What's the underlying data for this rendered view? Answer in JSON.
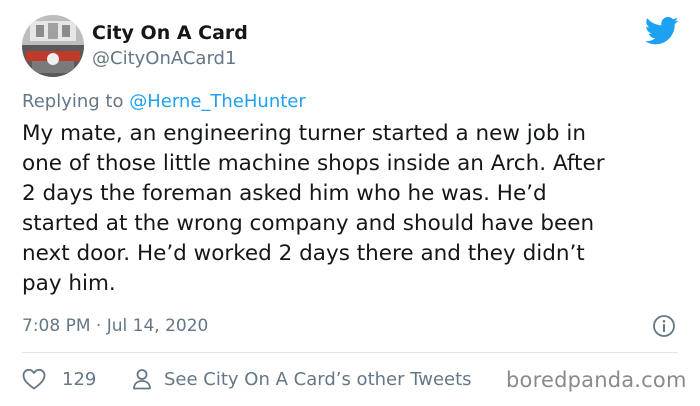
{
  "user": {
    "display_name": "City On A Card",
    "handle": "@CityOnACard1"
  },
  "reply": {
    "prefix": "Replying to",
    "mention": "@Herne_TheHunter"
  },
  "tweet": {
    "lines": [
      "My mate, an engineering turner started a new job in",
      "one of those little machine shops inside an Arch. After",
      "2 days the foreman asked him who he was. He’d",
      "started at the wrong company and should have been",
      "next door. He’d worked 2 days there and they didn’t",
      "pay him."
    ],
    "timestamp": "7:08 PM · Jul 14, 2020"
  },
  "actions": {
    "like_count": "129",
    "see_other_label": "See City On A Card’s other Tweets"
  },
  "watermark": "boredpanda.com",
  "icons": {
    "brand": "twitter-bird-icon",
    "like": "heart-icon",
    "profile": "person-icon",
    "info": "info-icon"
  },
  "colors": {
    "twitter_blue": "#1da1f2",
    "text_primary": "#14171a",
    "text_secondary": "#657786",
    "divider": "#e1e8ed"
  }
}
